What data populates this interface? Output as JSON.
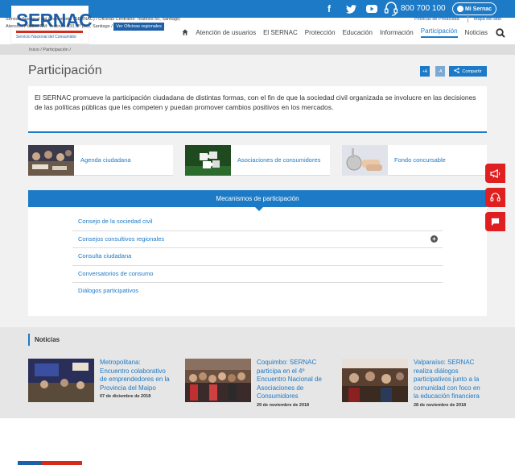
{
  "topbar": {
    "icons": [
      "facebook-icon",
      "twitter-icon",
      "youtube-icon",
      "headset-icon"
    ],
    "phone": "800 700 100",
    "mi_sernac": "Mi Sernac"
  },
  "logo": {
    "name": "SERNAC",
    "subtitle": "Servicio Nacional del Consumidor"
  },
  "nav": {
    "items": [
      "Atención de usuarios",
      "El SERNAC",
      "Protección",
      "Educación",
      "Información",
      "Participación",
      "Noticias"
    ],
    "active": "Participación"
  },
  "breadcrumb": "Inicio / Participación /",
  "page": {
    "title": "Participación",
    "font_plus": "+A",
    "font_minus": "-A",
    "share": "Compartir",
    "intro": "El SERNAC promueve la participación ciudadana de distintas formas, con el fin de que la sociedad civil organizada se involucre en las decisiones de las políticas públicas que les competen y puedan promover cambios positivos en los mercados."
  },
  "cards": [
    {
      "label": "Agenda ciudadana"
    },
    {
      "label": "Asociaciones de consumidores"
    },
    {
      "label": "Fondo concursable"
    }
  ],
  "mechanisms": {
    "title": "Mecanismos de participación",
    "items": [
      "Consejo de la sociedad civil",
      "Consejos consultivos regionales",
      "Consulta ciudadana",
      "Conversatorios de consumo",
      "Diálogos participativos"
    ]
  },
  "side_buttons": [
    "megaphone-icon",
    "headset-icon",
    "chat-icon"
  ],
  "news": {
    "title": "Noticias",
    "items": [
      {
        "headline": "Metropolitana: Encuentro colaborativo de emprendedores en la Provincia del Maipo",
        "date": "07 de diciembre de 2018"
      },
      {
        "headline": "Coquimbo: SERNAC participa en el 4º Encuentro Nacional de Asociaciones de Consumidores",
        "date": "29 de noviembre de 2018"
      },
      {
        "headline": "Valparaíso: SERNAC realiza diálogos participativos junto a la comunidad con foco en la educación financiera",
        "date": "28 de noviembre de 2018"
      }
    ]
  },
  "footer": {
    "address": "Servicio Nacional del Consumidor (SERNAC) / Oficinas Centrales: Teatinos 50, Santiago; Atención Público RM: Teatinos 333, 2º piso, Santiago /",
    "offices_button": "Ver Oficinas regionales",
    "privacy": "Políticas de Privacidad",
    "sitemap": "Mapa del sitio"
  },
  "colors": {
    "brand_blue": "#1d7ac6",
    "logo_blue": "#1d5fa8",
    "alert_red": "#e02020"
  }
}
